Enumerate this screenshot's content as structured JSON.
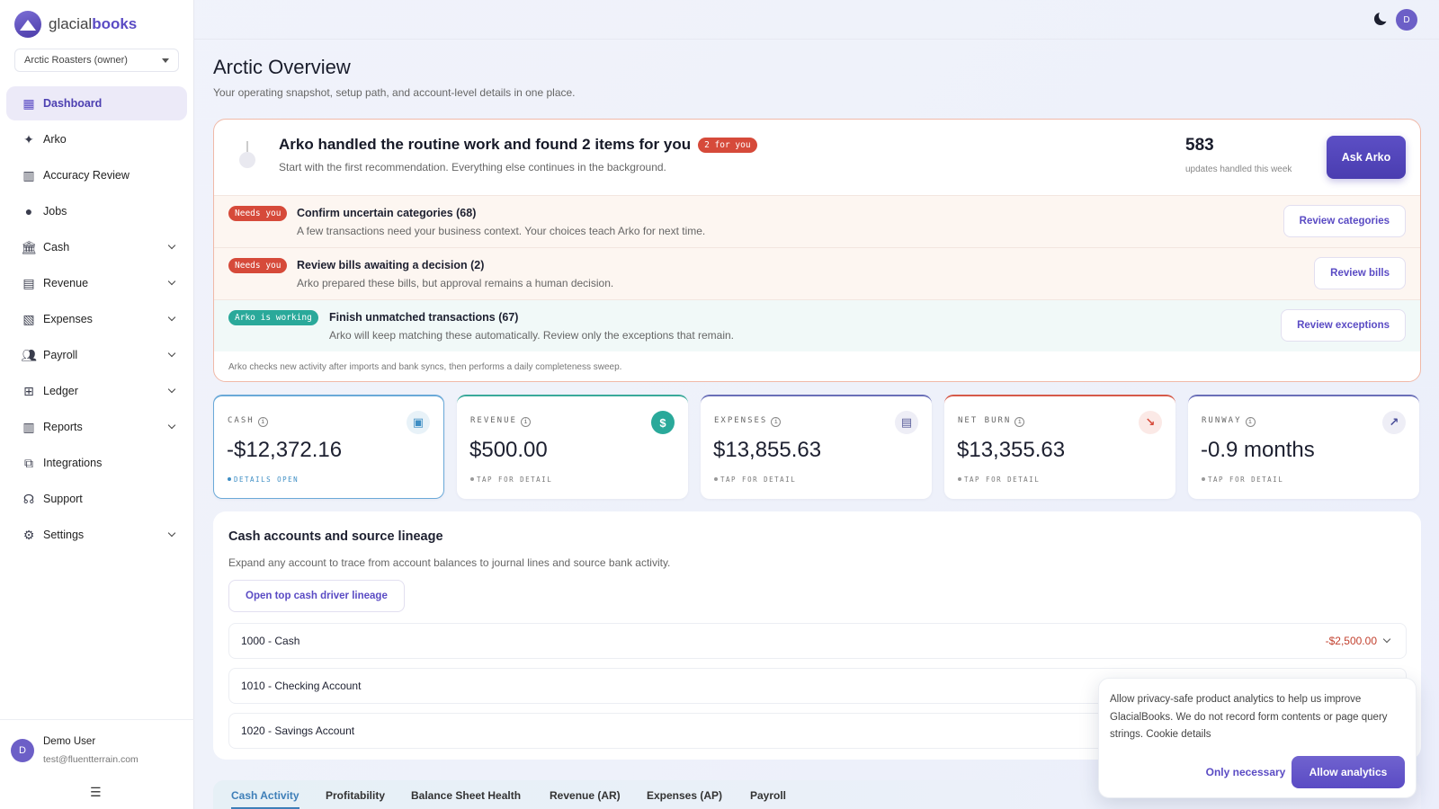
{
  "brand": {
    "name_light": "glacial",
    "name_bold": "books"
  },
  "org_selector": {
    "value": "Arctic Roasters (owner)"
  },
  "sidebar": {
    "items": [
      {
        "label": "Dashboard",
        "icon": "dashboard-icon",
        "active": true
      },
      {
        "label": "Arko",
        "icon": "sparkle-icon"
      },
      {
        "label": "Accuracy Review",
        "icon": "bar-chart-icon"
      },
      {
        "label": "Jobs",
        "icon": "jobs-icon"
      },
      {
        "label": "Cash",
        "icon": "bank-icon",
        "expandable": true
      },
      {
        "label": "Revenue",
        "icon": "receipt-icon",
        "expandable": true
      },
      {
        "label": "Expenses",
        "icon": "document-icon",
        "expandable": true
      },
      {
        "label": "Payroll",
        "icon": "people-icon",
        "expandable": true
      },
      {
        "label": "Ledger",
        "icon": "ledger-icon",
        "expandable": true
      },
      {
        "label": "Reports",
        "icon": "reports-icon",
        "expandable": true
      },
      {
        "label": "Integrations",
        "icon": "integrations-icon"
      },
      {
        "label": "Support",
        "icon": "headset-icon"
      },
      {
        "label": "Settings",
        "icon": "gear-icon",
        "expandable": true
      }
    ],
    "user": {
      "initial": "D",
      "name": "Demo User",
      "email": "test@fluentterrain.com"
    }
  },
  "topbar": {
    "avatar_initial": "D"
  },
  "page": {
    "title": "Arctic Overview",
    "subtitle": "Your operating snapshot, setup path, and account-level details in one place."
  },
  "arko": {
    "title": "Arko handled the routine work and found 2 items for you",
    "badge": "2 for you",
    "subtitle": "Start with the first recommendation. Everything else continues in the background.",
    "stat_value": "583",
    "stat_label": "updates handled this week",
    "ask_label": "Ask Arko",
    "recommendations": [
      {
        "badge": "Needs you",
        "title": "Confirm uncertain categories (68)",
        "desc": "A few transactions need your business context. Your choices teach Arko for next time.",
        "button": "Review categories"
      },
      {
        "badge": "Needs you",
        "title": "Review bills awaiting a decision (2)",
        "desc": "Arko prepared these bills, but approval remains a human decision.",
        "button": "Review bills"
      },
      {
        "badge": "Arko is working",
        "title": "Finish unmatched transactions (67)",
        "desc": "Arko will keep matching these automatically. Review only the exceptions that remain.",
        "button": "Review exceptions"
      }
    ],
    "footer": "Arko checks new activity after imports and bank syncs, then performs a daily completeness sweep."
  },
  "kpis": [
    {
      "label": "CASH",
      "value": "-$12,372.16",
      "foot": "DETAILS OPEN",
      "icon": "wallet-icon",
      "accent": "#6aa9d8"
    },
    {
      "label": "REVENUE",
      "value": "$500.00",
      "foot": "TAP FOR DETAIL",
      "icon": "dollar-icon",
      "accent": "#3aa99a"
    },
    {
      "label": "EXPENSES",
      "value": "$13,855.63",
      "foot": "TAP FOR DETAIL",
      "icon": "receipt-icon",
      "accent": "#6a6fb8"
    },
    {
      "label": "NET BURN",
      "value": "$13,355.63",
      "foot": "TAP FOR DETAIL",
      "icon": "trend-down-icon",
      "accent": "#d65a4a"
    },
    {
      "label": "RUNWAY",
      "value": "-0.9 months",
      "foot": "TAP FOR DETAIL",
      "icon": "trend-up-icon",
      "accent": "#6a6fb8"
    }
  ],
  "cash_panel": {
    "title": "Cash accounts and source lineage",
    "subtitle": "Expand any account to trace from account balances to journal lines and source bank activity.",
    "lineage_button": "Open top cash driver lineage",
    "accounts": [
      {
        "name": "1000 - Cash",
        "value": "-$2,500.00"
      },
      {
        "name": "1010 - Checking Account",
        "value": ""
      },
      {
        "name": "1020 - Savings Account",
        "value": ""
      }
    ]
  },
  "tabs": [
    "Cash Activity",
    "Profitability",
    "Balance Sheet Health",
    "Revenue (AR)",
    "Expenses (AP)",
    "Payroll"
  ],
  "cookie": {
    "text": "Allow privacy-safe product analytics to help us improve GlacialBooks. We do not record form contents or page query strings.",
    "details_link": "Cookie details",
    "necessary_label": "Only necessary",
    "allow_label": "Allow analytics"
  }
}
